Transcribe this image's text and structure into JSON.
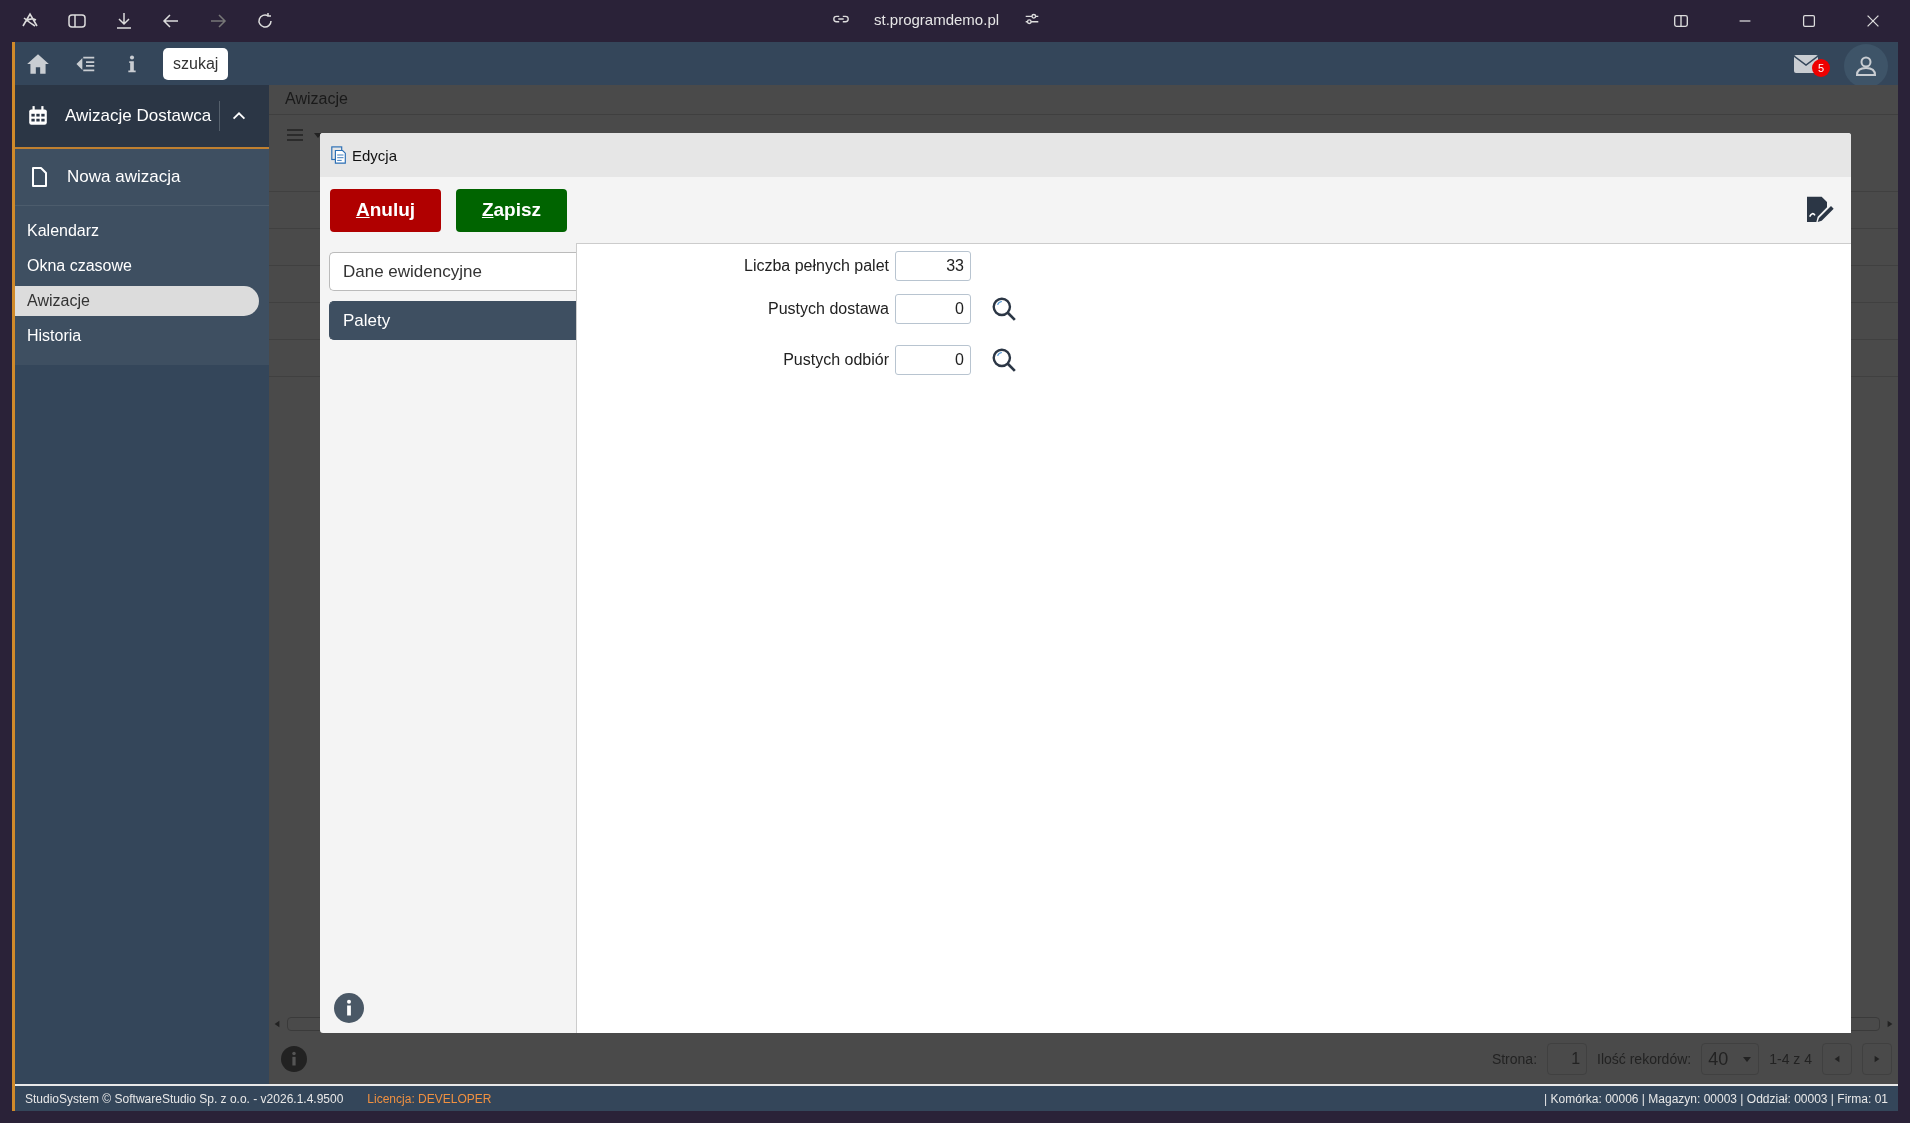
{
  "browser": {
    "url": "st.programdemo.pl"
  },
  "header": {
    "search_label": "szukaj",
    "mail_count": "5"
  },
  "sidebar": {
    "module": "Awizacje Dostawca",
    "expanded": true,
    "new_item": "Nowa awizacja",
    "items": [
      {
        "label": "Kalendarz",
        "selected": false
      },
      {
        "label": "Okna czasowe",
        "selected": false
      },
      {
        "label": "Awizacje",
        "selected": true
      },
      {
        "label": "Historia",
        "selected": false
      }
    ]
  },
  "page": {
    "title": "Awizacje",
    "pager": {
      "page_label": "Strona:",
      "page": "1",
      "records_label": "Ilość rekordów:",
      "records": "40",
      "range": "1-4 z 4"
    }
  },
  "dialog": {
    "title": "Edycja",
    "buttons": [
      {
        "label": "Anuluj",
        "kind": "cancel"
      },
      {
        "label": "Zapisz",
        "kind": "save"
      }
    ],
    "tabs": [
      {
        "label": "Dane ewidencyjne",
        "selected": false
      },
      {
        "label": "Palety",
        "selected": true
      }
    ],
    "fields": [
      {
        "label": "Liczba pełnych palet",
        "value": "33",
        "lookup": false
      },
      {
        "label": "Pustych dostawa",
        "value": "0",
        "lookup": true
      },
      {
        "label": "Pustych odbiór",
        "value": "0",
        "lookup": true
      }
    ]
  },
  "footer": {
    "copyright": "StudioSystem © SoftwareStudio Sp. z o.o. - v2026.1.4.9500",
    "license": "Licencja: DEVELOPER",
    "context": "| Komórka: 00006 | Magazyn: 00003 | Oddział: 00003 | Firma: 01"
  }
}
